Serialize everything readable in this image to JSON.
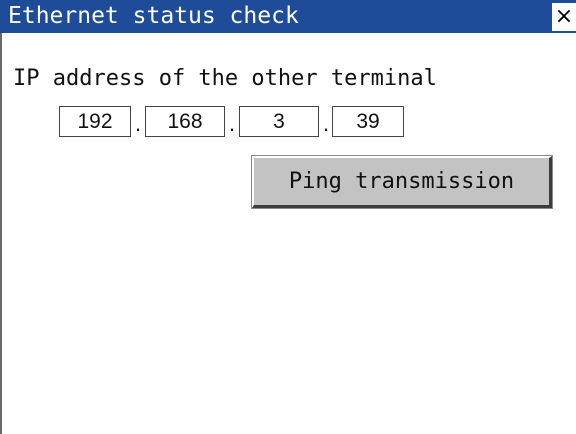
{
  "window": {
    "title": "Ethernet status check",
    "close_label": "×"
  },
  "form": {
    "ip_label": "IP address of the other terminal",
    "ip_octets": [
      "192",
      "168",
      "3",
      "39"
    ],
    "separator": "."
  },
  "actions": {
    "ping_label": "Ping transmission"
  },
  "colors": {
    "titlebar": "#1e4c98",
    "button_face": "#c3c3c3"
  }
}
